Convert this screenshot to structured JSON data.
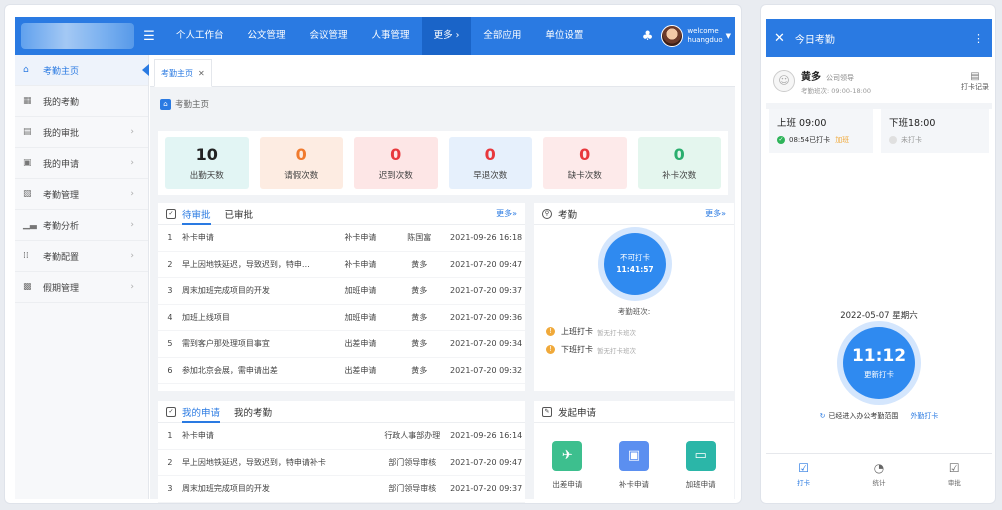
{
  "topnav": {
    "items": [
      "个人工作台",
      "公文管理",
      "会议管理",
      "人事管理",
      "更多 ›",
      "全部应用",
      "单位设置"
    ],
    "welcome": "welcome",
    "username": "huangduo"
  },
  "sidebar": {
    "items": [
      {
        "label": "考勤主页",
        "icon": "home-icon",
        "active": true
      },
      {
        "label": "我的考勤",
        "icon": "calendar-icon"
      },
      {
        "label": "我的审批",
        "icon": "approve-icon"
      },
      {
        "label": "我的申请",
        "icon": "apply-icon"
      },
      {
        "label": "考勤管理",
        "icon": "manage-icon"
      },
      {
        "label": "考勤分析",
        "icon": "chart-icon"
      },
      {
        "label": "考勤配置",
        "icon": "config-icon"
      },
      {
        "label": "假期管理",
        "icon": "holiday-icon"
      }
    ]
  },
  "tabs": {
    "active_label": "考勤主页"
  },
  "breadcrumb": "考勤主页",
  "stats": [
    {
      "value": "10",
      "label": "出勤天数",
      "bg": "#e2f5f4",
      "color": "#222222"
    },
    {
      "value": "0",
      "label": "请假次数",
      "bg": "#fdece2",
      "color": "#f07a2d"
    },
    {
      "value": "0",
      "label": "迟到次数",
      "bg": "#fde6e6",
      "color": "#e8383d"
    },
    {
      "value": "0",
      "label": "早退次数",
      "bg": "#e6f0fc",
      "color": "#e8383d"
    },
    {
      "value": "0",
      "label": "缺卡次数",
      "bg": "#fdeaea",
      "color": "#e8383d"
    },
    {
      "value": "0",
      "label": "补卡次数",
      "bg": "#e4f6ee",
      "color": "#2aae6e"
    }
  ],
  "approval_panel": {
    "tab_pending": "待审批",
    "tab_done": "已审批",
    "more": "更多»",
    "rows": [
      {
        "no": "1",
        "title": "补卡申请",
        "type": "补卡申请",
        "user": "陈国富",
        "time": "2021-09-26 16:18"
      },
      {
        "no": "2",
        "title": "早上因地铁延迟，导致迟到，特申…",
        "type": "补卡申请",
        "user": "黄多",
        "time": "2021-07-20 09:47"
      },
      {
        "no": "3",
        "title": "周末加班完成项目的开发",
        "type": "加班申请",
        "user": "黄多",
        "time": "2021-07-20 09:37"
      },
      {
        "no": "4",
        "title": "加班上线项目",
        "type": "加班申请",
        "user": "黄多",
        "time": "2021-07-20 09:36"
      },
      {
        "no": "5",
        "title": "需到客户那处理项目事宜",
        "type": "出差申请",
        "user": "黄多",
        "time": "2021-07-20 09:34"
      },
      {
        "no": "6",
        "title": "参加北京会展，需申请出差",
        "type": "出差申请",
        "user": "黄多",
        "time": "2021-07-20 09:32"
      }
    ]
  },
  "attendance_panel": {
    "title": "考勤",
    "more": "更多»",
    "status": "不可打卡",
    "time": "11:41:57",
    "shift_title": "考勤班次:",
    "checkin_label": "上班打卡",
    "checkin_sub": "暂无打卡班次",
    "checkout_label": "下班打卡",
    "checkout_sub": "暂无打卡班次"
  },
  "my_apply_panel": {
    "tab_apply": "我的申请",
    "tab_attendance": "我的考勤",
    "rows": [
      {
        "no": "1",
        "title": "补卡申请",
        "status": "行政人事部办理",
        "time": "2021-09-26 16:14"
      },
      {
        "no": "2",
        "title": "早上因地铁延迟，导致迟到，特申请补卡",
        "status": "部门领导审核",
        "time": "2021-07-20 09:47"
      },
      {
        "no": "3",
        "title": "周末加班完成项目的开发",
        "status": "部门领导审核",
        "time": "2021-07-20 09:37"
      }
    ]
  },
  "launch_panel": {
    "title": "发起申请",
    "items": [
      {
        "label": "出差申请",
        "glyph": "✈",
        "color": "#3dbf8e"
      },
      {
        "label": "补卡申请",
        "glyph": "▣",
        "color": "#5b8ff0"
      },
      {
        "label": "加班申请",
        "glyph": "▭",
        "color": "#2bb6a8"
      }
    ]
  },
  "mobile": {
    "title": "今日考勤",
    "user_name": "黄多",
    "user_role": "公司领导",
    "shift": "考勤班次: 09:00-18:00",
    "record_label": "打卡记录",
    "on_title": "上班 09:00",
    "on_status": "08:54已打卡",
    "on_tag": "加班",
    "off_title": "下班18:00",
    "off_status": "未打卡",
    "date": "2022-05-07 星期六",
    "clock_time": "11:12",
    "clock_action": "更新打卡",
    "range_text": "已经进入办公考勤范围",
    "outside": "外勤打卡",
    "bottom": [
      {
        "label": "打卡",
        "glyph": "☑",
        "active": true
      },
      {
        "label": "统计",
        "glyph": "◔"
      },
      {
        "label": "审批",
        "glyph": "☑"
      }
    ]
  }
}
